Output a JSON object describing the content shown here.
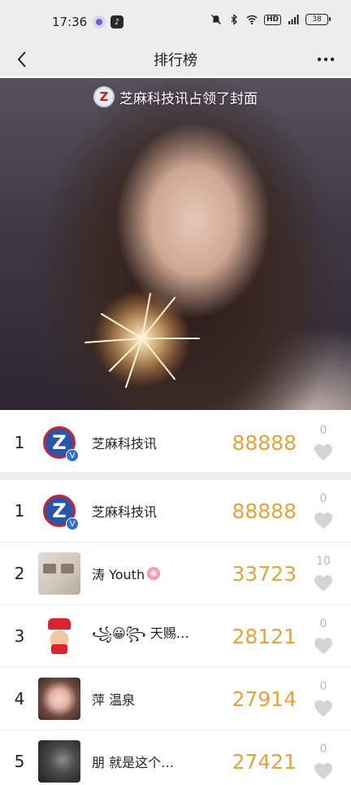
{
  "status_bar": {
    "time": "17:36",
    "hd_label": "HD",
    "battery_level": "38"
  },
  "nav": {
    "title": "排行榜",
    "back_icon": "chevron-left-icon",
    "more_icon": "more-dots-icon"
  },
  "cover": {
    "credit_text": "芝麻科技讯占领了封面",
    "credit_logo_letter": "Z"
  },
  "my_rank": {
    "rank": "1",
    "name": "芝麻科技讯",
    "steps": "88888",
    "likes": "0",
    "verified_badge": "V"
  },
  "ranking": [
    {
      "rank": "1",
      "name": "芝麻科技讯",
      "steps": "88888",
      "likes": "0"
    },
    {
      "rank": "2",
      "name": "涛 Youth",
      "steps": "33723",
      "likes": "10"
    },
    {
      "rank": "3",
      "name": "꧁😀꧂ 天赐…",
      "steps": "28121",
      "likes": "0"
    },
    {
      "rank": "4",
      "name": "萍 温泉",
      "steps": "27914",
      "likes": "0"
    },
    {
      "rank": "5",
      "name": "朋 就是这个…",
      "steps": "27421",
      "likes": "0"
    }
  ],
  "colors": {
    "steps": "#e3a33e",
    "likes": "#b8b8b8",
    "header_bg": "#ededed"
  }
}
